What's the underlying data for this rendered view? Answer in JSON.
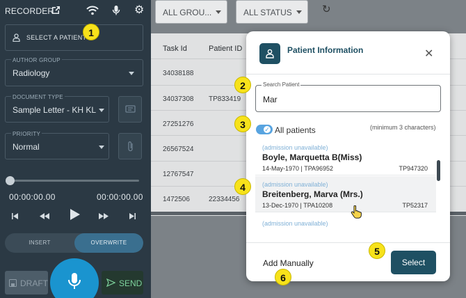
{
  "recorder": {
    "title": "RECORDER",
    "select_patient_label": "SELECT A PATIENT",
    "author_group": {
      "label": "AUTHOR GROUP",
      "value": "Radiology"
    },
    "document_type": {
      "label": "DOCUMENT TYPE",
      "value": "Sample Letter - KH KL"
    },
    "priority": {
      "label": "PRIORITY",
      "value": "Normal"
    },
    "time_start": "00:00:00.00",
    "time_end": "00:00:00.00",
    "progress": 0,
    "mode": {
      "insert": "INSERT",
      "overwrite": "OVERWRITE",
      "selected": "overwrite"
    },
    "draft_label": "DRAFT",
    "send_label": "SEND"
  },
  "filters": {
    "group": "ALL GROU...",
    "status": "ALL STATUS"
  },
  "table": {
    "headers": [
      "Task Id",
      "Patient ID"
    ],
    "rows": [
      {
        "task_id": "34038188",
        "patient_id": ""
      },
      {
        "task_id": "34037308",
        "patient_id": "TP833419"
      },
      {
        "task_id": "27251276",
        "patient_id": ""
      },
      {
        "task_id": "26567524",
        "patient_id": ""
      },
      {
        "task_id": "12767547",
        "patient_id": ""
      },
      {
        "task_id": "1472506",
        "patient_id": "22334456"
      }
    ]
  },
  "modal": {
    "title": "Patient Information",
    "search": {
      "label": "Search Patient",
      "value": "Mar"
    },
    "all_patients_label": "All patients",
    "all_patients_checked": true,
    "min_chars_hint": "(minimum 3 characters)",
    "patients": [
      {
        "status": "(admission unavailable)",
        "name": "Boyle, Marquetta B(Miss)",
        "dob_id": "14-May-1970 | TPA96952",
        "tp": "TP947320"
      },
      {
        "status": "(admission unavailable)",
        "name": "Breitenberg, Marva (Mrs.)",
        "dob_id": "13-Dec-1970 | TPA10208",
        "tp": "TP52317"
      },
      {
        "status": "(admission unavailable)",
        "name": "",
        "dob_id": "",
        "tp": ""
      }
    ],
    "add_manually_label": "Add Manually",
    "select_label": "Select"
  },
  "callouts": [
    "1",
    "2",
    "3",
    "4",
    "5",
    "6"
  ],
  "colors": {
    "panel": "#2b3944",
    "accent": "#1f5063",
    "toggle": "#58a4e0",
    "callout": "#f7e21b",
    "send": "#3c7a52"
  }
}
